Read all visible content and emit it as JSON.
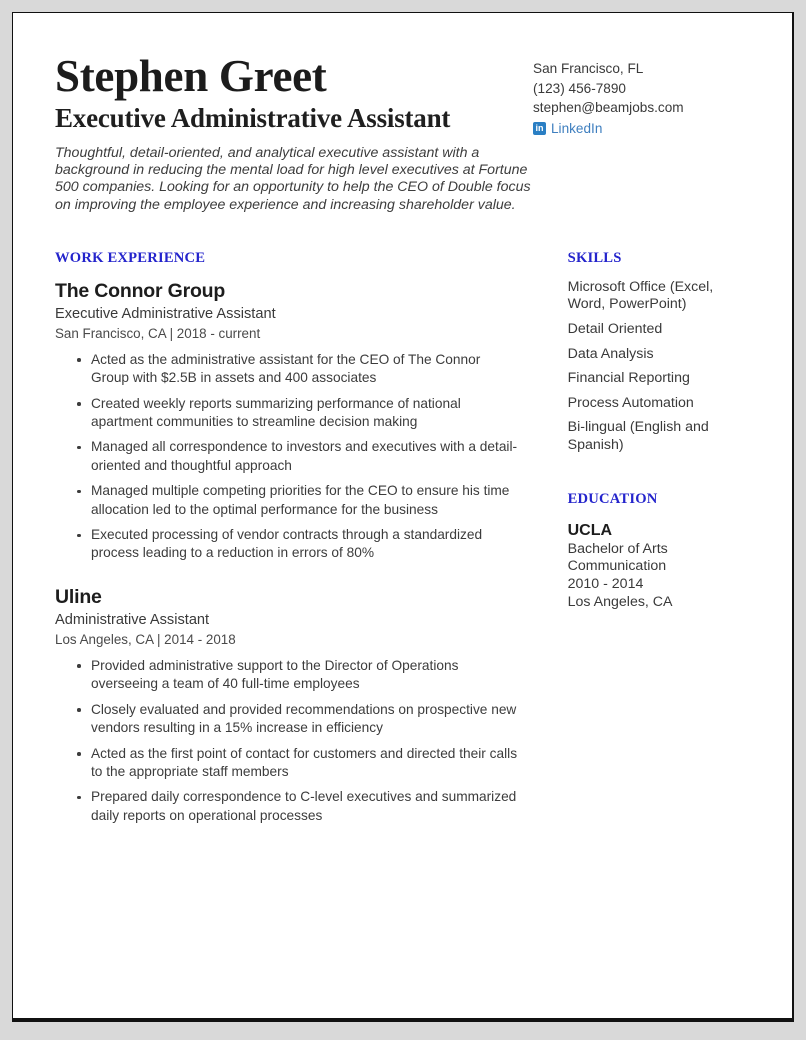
{
  "header": {
    "name": "Stephen Greet",
    "title": "Executive Administrative Assistant",
    "summary": "Thoughtful, detail-oriented, and analytical executive assistant with a background in reducing the mental load for high level executives at Fortune 500 companies. Looking for an opportunity to help the CEO of Double focus on improving the employee experience and increasing shareholder value.",
    "contact": {
      "location": "San Francisco, FL",
      "phone": "(123) 456-7890",
      "email": "stephen@beamjobs.com",
      "linkedin_label": "LinkedIn",
      "linkedin_icon_text": "in"
    }
  },
  "work_experience": {
    "heading": "WORK EXPERIENCE",
    "jobs": [
      {
        "company": "The Connor Group",
        "role": "Executive Administrative Assistant",
        "meta": "San Francisco, CA  |  2018 - current",
        "bullets": [
          "Acted as the administrative assistant for the CEO of The Connor Group with $2.5B in assets and 400 associates",
          "Created weekly reports summarizing performance of national apartment communities to streamline decision making",
          "Managed all correspondence to investors and executives with a detail-oriented and thoughtful approach",
          "Managed multiple competing priorities for the CEO to ensure his time allocation led to the optimal performance for the business",
          "Executed processing of vendor contracts through a standardized process leading to a reduction in errors of 80%"
        ]
      },
      {
        "company": "Uline",
        "role": "Administrative Assistant",
        "meta": "Los Angeles, CA  |  2014 - 2018",
        "bullets": [
          "Provided administrative support to the Director of Operations overseeing a team of 40 full-time employees",
          "Closely evaluated and provided recommendations on prospective new vendors resulting in a 15% increase in efficiency",
          "Acted as the first point of contact for customers and directed their calls to the appropriate staff members",
          "Prepared daily correspondence to C-level executives and summarized daily reports on operational processes"
        ]
      }
    ]
  },
  "skills": {
    "heading": "SKILLS",
    "items": [
      "Microsoft Office (Excel, Word, PowerPoint)",
      "Detail Oriented",
      "Data Analysis",
      "Financial Reporting",
      "Process Automation",
      "Bi-lingual (English and Spanish)"
    ]
  },
  "education": {
    "heading": "EDUCATION",
    "school": "UCLA",
    "degree": "Bachelor of Arts",
    "field": "Communication",
    "years": "2010 - 2014",
    "location": "Los Angeles, CA"
  },
  "colors": {
    "accent_blue": "#2424cc",
    "link_blue": "#3f7fbf",
    "linkedin_icon_bg": "#2a7fc4",
    "body_text": "#3a3a3a",
    "heading_text": "#1c1c1c",
    "page_background": "#ffffff",
    "canvas_background": "#d9d9d9"
  }
}
